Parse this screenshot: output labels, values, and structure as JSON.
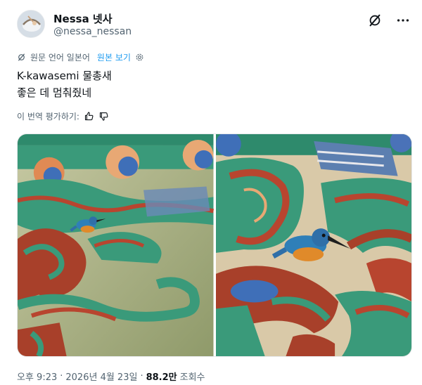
{
  "author": {
    "display_name": "Nessa 넷사",
    "handle": "@nessa_nessan"
  },
  "header_icons": [
    "grok-icon",
    "more-icon"
  ],
  "translation": {
    "prefix": "원문 언어 일본어",
    "show_original": "원본 보기"
  },
  "tweet": {
    "line1": "K-kawasemi 물총새",
    "line2": "좋은 데 멈춰줬네"
  },
  "rate": {
    "label": "이 번역 평가하기:"
  },
  "media": {
    "photos": [
      {
        "subject": "kingfisher perched on painted temple eaves (dancheong)"
      },
      {
        "subject": "close-up of kingfisher on painted temple bracket"
      }
    ]
  },
  "meta": {
    "time": "오후 9:23",
    "dot": "·",
    "date": "2026년 4월 23일",
    "dot2": "·",
    "views_count": "88.2만",
    "views_label": "조회수"
  },
  "colors": {
    "accent": "#1d9bf0",
    "muted": "#536471",
    "text": "#0f1419",
    "dancheong_green": "#3a9a7a",
    "dancheong_red": "#b8452f",
    "kingfisher_blue": "#2f7fb8",
    "kingfisher_orange": "#e08a2a"
  }
}
